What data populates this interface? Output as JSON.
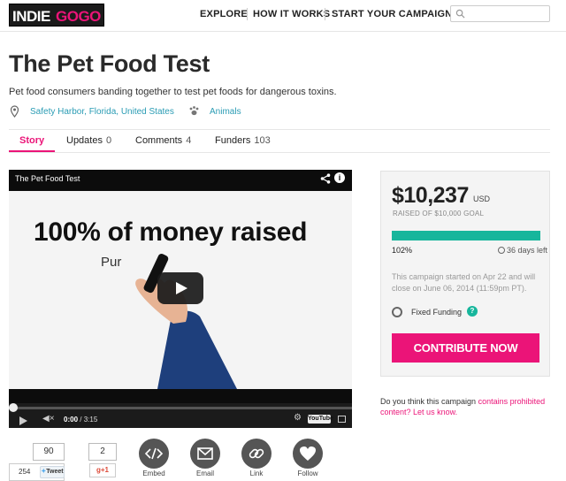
{
  "header": {
    "logo_left": "INDIE",
    "logo_right": "GOGO",
    "nav": [
      "EXPLORE",
      "HOW IT WORKS",
      "START YOUR CAMPAIGN"
    ],
    "search": {
      "placeholder": "",
      "icon": "search-icon"
    }
  },
  "campaign": {
    "title": "The Pet Food Test",
    "tagline": "Pet food consumers banding together to test pet foods for dangerous toxins.",
    "location": "Safety Harbor, Florida, United States",
    "category": "Animals"
  },
  "tabs": [
    {
      "label": "Story",
      "count": "",
      "active": true
    },
    {
      "label": "Updates",
      "count": "0",
      "active": false
    },
    {
      "label": "Comments",
      "count": "4",
      "active": false
    },
    {
      "label": "Funders",
      "count": "103",
      "active": false
    }
  ],
  "video": {
    "title": "The Pet Food Test",
    "headline": "100% of money raised",
    "subline": "Pur",
    "time_current": "0:00",
    "time_total": "/ 3:15",
    "progress": 0,
    "youtube_label": "YouTube"
  },
  "social": {
    "tweet_share_count": "90",
    "tweet_count": "254",
    "tweet_label": "Tweet",
    "gplus_count": "2",
    "gplus_label": "g+1",
    "actions": [
      {
        "label": "Embed",
        "icon": "embed-icon"
      },
      {
        "label": "Email",
        "icon": "email-icon"
      },
      {
        "label": "Link",
        "icon": "link-icon"
      },
      {
        "label": "Follow",
        "icon": "heart-icon"
      }
    ]
  },
  "funding": {
    "amount": "$10,237",
    "currency": "USD",
    "goal_text": "RAISED OF $10,000 GOAL",
    "percent_label": "102%",
    "percent_value": 102,
    "days_left": "36 days left",
    "note": "This campaign started on Apr 22 and will close on June 06, 2014 (11:59pm PT).",
    "funding_type": "Fixed Funding",
    "help_label": "?",
    "cta": "CONTRIBUTE NOW"
  },
  "prohibited": {
    "lead": "Do you think this campaign ",
    "link1": "contains prohibited content?",
    "link2": "Let us know."
  },
  "colors": {
    "brand": "#eb1478",
    "progress": "#17b69c",
    "link": "#2a9cb4"
  }
}
